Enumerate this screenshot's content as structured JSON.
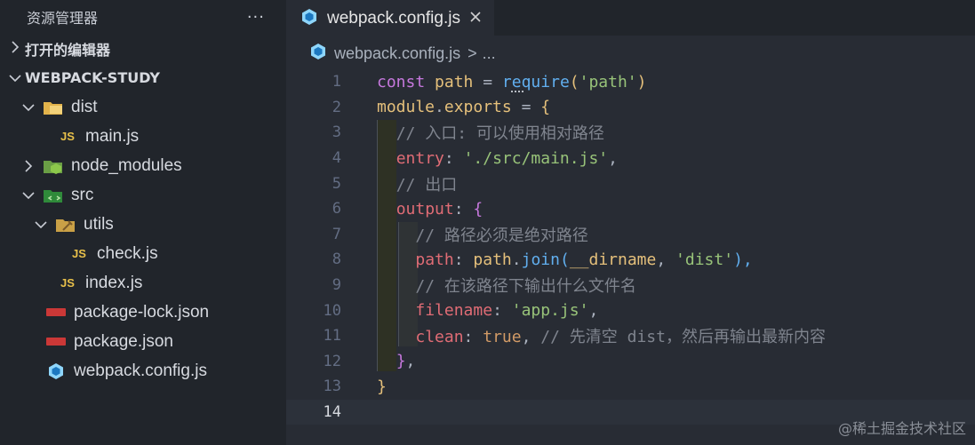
{
  "sidebar": {
    "title": "资源管理器",
    "more": "···",
    "open_editors": "打开的编辑器",
    "project": "WEBPACK-STUDY",
    "tree": [
      {
        "label": "dist",
        "icon": "folder-dist-icon"
      },
      {
        "label": "main.js",
        "icon": "js-file-icon"
      },
      {
        "label": "node_modules",
        "icon": "folder-node-icon"
      },
      {
        "label": "src",
        "icon": "folder-src-icon"
      },
      {
        "label": "utils",
        "icon": "folder-utils-icon"
      },
      {
        "label": "check.js",
        "icon": "js-file-icon"
      },
      {
        "label": "index.js",
        "icon": "js-file-icon"
      },
      {
        "label": "package-lock.json",
        "icon": "npm-icon"
      },
      {
        "label": "package.json",
        "icon": "npm-icon"
      },
      {
        "label": "webpack.config.js",
        "icon": "webpack-icon"
      }
    ]
  },
  "editor": {
    "tab_label": "webpack.config.js",
    "breadcrumb_file": "webpack.config.js",
    "breadcrumb_sep": ">",
    "breadcrumb_more": "...",
    "js_badge": "JS",
    "lines": [
      "1",
      "2",
      "3",
      "4",
      "5",
      "6",
      "7",
      "8",
      "9",
      "10",
      "11",
      "12",
      "13",
      "14"
    ],
    "code": {
      "l1": [
        "const",
        "path",
        "=",
        "require",
        "(",
        "'path'",
        ")"
      ],
      "l2": [
        "module",
        ".",
        "exports",
        "=",
        "{"
      ],
      "l3": "// 入口: 可以使用相对路径",
      "l4": [
        "entry",
        ": ",
        "'./src/main.js'",
        ","
      ],
      "l5": "// 出口",
      "l6": [
        "output",
        ": ",
        "{"
      ],
      "l7": "// 路径必须是绝对路径",
      "l8": [
        "path",
        ": ",
        "path",
        ".",
        "join",
        "(",
        "__dirname",
        ", ",
        "'dist'",
        "),"
      ],
      "l9": "// 在该路径下输出什么文件名",
      "l10": [
        "filename",
        ": ",
        "'app.js'",
        ","
      ],
      "l11": [
        "clean",
        ": ",
        "true",
        ", ",
        "// 先清空 dist，然后再输出最新内容"
      ],
      "l12": [
        "}",
        ","
      ],
      "l13": "}"
    }
  },
  "watermark": "@稀土掘金技术社区"
}
